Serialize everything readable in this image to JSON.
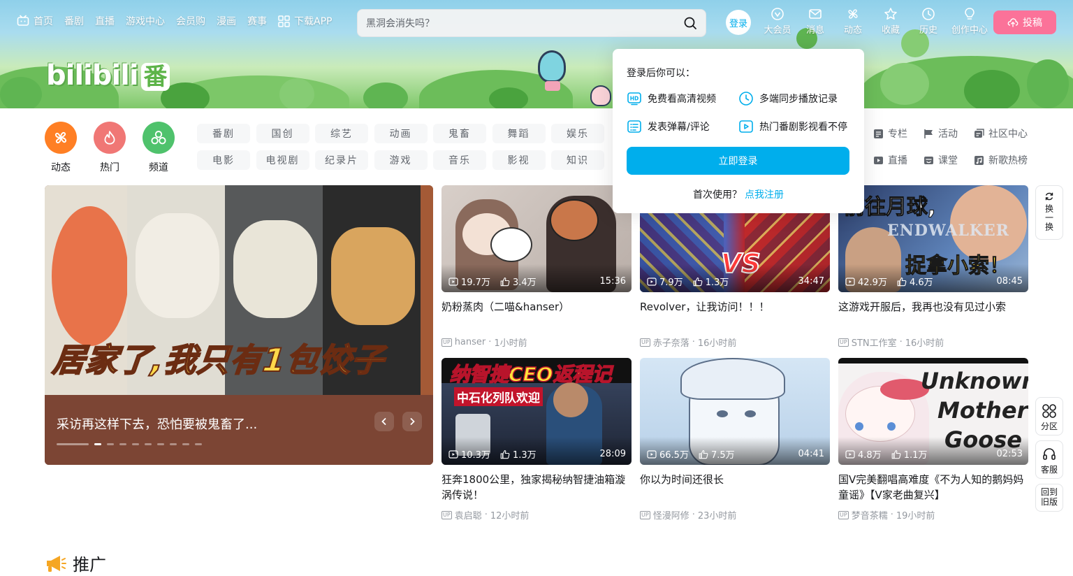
{
  "nav": {
    "items": [
      {
        "label": "首页",
        "icon": "tv-icon"
      },
      {
        "label": "番剧"
      },
      {
        "label": "直播"
      },
      {
        "label": "游戏中心"
      },
      {
        "label": "会员购"
      },
      {
        "label": "漫画"
      },
      {
        "label": "赛事"
      },
      {
        "label": "下载APP",
        "icon": "qr-grid-icon"
      }
    ],
    "search_placeholder": "黑洞会消失吗？",
    "login": "登录",
    "right": [
      {
        "label": "大会员"
      },
      {
        "label": "消息"
      },
      {
        "label": "动态"
      },
      {
        "label": "收藏"
      },
      {
        "label": "历史"
      },
      {
        "label": "创作中心"
      }
    ],
    "upload": "投稿"
  },
  "logo": {
    "text": "bilibili",
    "badge": "番"
  },
  "channels": {
    "circles": [
      {
        "label": "动态",
        "color": "#ff6699"
      },
      {
        "label": "热门",
        "color": "#f07775"
      },
      {
        "label": "频道",
        "color": "#4fc26c"
      }
    ],
    "tags": [
      "番剧",
      "国创",
      "综艺",
      "动画",
      "鬼畜",
      "舞蹈",
      "娱乐",
      "电影",
      "电视剧",
      "纪录片",
      "游戏",
      "音乐",
      "影视",
      "知识"
    ],
    "links": [
      "专栏",
      "活动",
      "社区中心",
      "直播",
      "课堂",
      "新歌热榜"
    ]
  },
  "carousel": {
    "bigtext": "居家了,我只有1包饺子",
    "caption": "采访再这样下去，恐怕要被鬼畜了..."
  },
  "videos": [
    {
      "views": "19.7万",
      "likes": "3.4万",
      "duration": "15:36",
      "title": "奶粉蒸肉（二喵&hanser）",
      "author": "hanser",
      "time": "1小时前"
    },
    {
      "views": "7.9万",
      "likes": "1.3万",
      "duration": "34:47",
      "title": "Revolver，让我访问！！！",
      "author": "赤子奈落",
      "time": "16小时前",
      "art": "VS"
    },
    {
      "views": "42.9万",
      "likes": "4.6万",
      "duration": "08:45",
      "title": "这游戏开服后，我再也没有见过小索",
      "author": "STN工作室",
      "time": "16小时前",
      "art1": "前往月球,",
      "art2": "ENDWALKER",
      "art3": "捉拿小索！"
    },
    {
      "views": "10.3万",
      "likes": "1.3万",
      "duration": "28:09",
      "title": "狂奔1800公里，独家揭秘纳智捷油箱漩涡传说！",
      "author": "袁启聪",
      "time": "12小时前",
      "art1": "纳智捷CEO返程记",
      "art2": "中石化列队欢迎"
    },
    {
      "views": "66.5万",
      "likes": "7.5万",
      "duration": "04:41",
      "title": "你以为时间还很长",
      "author": "怪漫阿修",
      "time": "23小时前"
    },
    {
      "views": "4.8万",
      "likes": "1.1万",
      "duration": "02:53",
      "title": "国V完美翻唱高难度《不为人知的鹅妈妈童谣》【V家老曲复兴】",
      "author": "梦音茶糯",
      "time": "19小时前",
      "art1": "Unknown",
      "art2": "Mother",
      "art3": "Goose"
    }
  ],
  "float": {
    "refresh": "换一换",
    "zone": "分区",
    "service": "客服",
    "old": "回到旧版"
  },
  "popover": {
    "title": "登录后你可以：",
    "benefits": [
      "免费看高清视频",
      "多端同步播放记录",
      "发表弹幕/评论",
      "热门番剧影视看不停"
    ],
    "button": "立即登录",
    "reg_prefix": "首次使用？",
    "reg_link": "点我注册"
  },
  "promo": "推广",
  "colors": {
    "accent": "#00aeec",
    "pink": "#fb7299"
  }
}
